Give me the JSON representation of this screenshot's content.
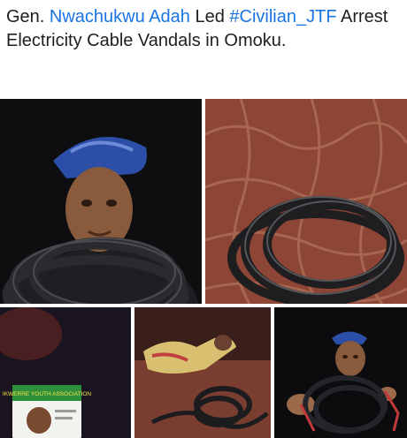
{
  "post": {
    "prefix": "Gen. ",
    "mention": "Nwachukwu Adah",
    "after_mention": " Led ",
    "hashtag": "#Civilian_JTF",
    "rest": " Arrest Electricity Cable Vandals in Omoku."
  },
  "colors": {
    "text": "#1c1e21",
    "link": "#1b74e4"
  },
  "photos": {
    "badge_text": "IKWERRE YOUTH ASSOCIATION"
  }
}
